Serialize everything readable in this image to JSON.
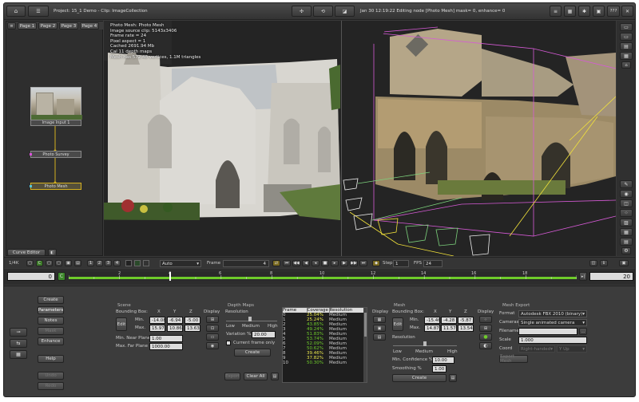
{
  "titlebar": {
    "project": "Project: 15_1 Demo - Clip: ImageCollection",
    "status": "Jan 30 12:19:22 Editing node [Photo Mesh] mask= 0, enhance= 0",
    "help_label": "???"
  },
  "tabs": [
    "Page 1",
    "Page 2",
    "Page 3",
    "Page 4"
  ],
  "nodes": [
    {
      "label": "Image Input 1"
    },
    {
      "label": "Photo Survey"
    },
    {
      "label": "Photo Mesh"
    }
  ],
  "left_bottom_tab": "Curve Editor",
  "viewport_overlay": [
    "Photo Mesh: Photo Mesh",
    "Image source clip: 5143x3406",
    "Frame rate = 24",
    "Pixel aspect = 1",
    "Cached 2691.94 Mb",
    "Cal 11 depth maps",
    "Mesh has 572.48 vertices, 1.1M triangles"
  ],
  "transport": {
    "zoom": "1/4K",
    "view_buttons": [
      "1",
      "2",
      "3",
      "4"
    ],
    "mode": "Auto",
    "frame_label": "Frame",
    "frame_value": "4",
    "step_label": "Step",
    "step_value": "1",
    "fps_label": "FPS",
    "fps_value": "24"
  },
  "timeline": {
    "start": "0",
    "end": "20",
    "ticks": [
      "2",
      "4",
      "6",
      "8",
      "10",
      "12",
      "14",
      "16",
      "18"
    ],
    "current_frame": 4
  },
  "left_buttons": [
    "Create",
    "Parameters",
    "Notes",
    "Mask",
    "Enhance",
    "Help",
    "Undo",
    "Redo"
  ],
  "scene": {
    "title": "Scene",
    "bbox_label": "Bounding Box:",
    "edit": "Edit",
    "axes": [
      "X",
      "Y",
      "Z"
    ],
    "display": "Display",
    "min_label": "Min.",
    "max_label": "Max.",
    "min": [
      "-14.08",
      "-6.94",
      "-5.00"
    ],
    "max": [
      "15.97",
      "10.86",
      "13.63"
    ],
    "near_label": "Min. Near Plane",
    "near_value": "1.00",
    "far_label": "Max. Far Plane",
    "far_value": "1000.00"
  },
  "depth_maps": {
    "title": "Depth Maps",
    "resolution": "Resolution",
    "low": "Low",
    "medium": "Medium",
    "high": "High",
    "variation_label": "Variation %",
    "variation_value": "20.00",
    "current_only": "Current frame only",
    "create": "Create",
    "export": "Export",
    "clear_all": "Clear All",
    "display": "Display",
    "columns": [
      "Frame",
      "Coverage",
      "Resolution"
    ],
    "rows": [
      [
        "0",
        "25.04%",
        "Medium"
      ],
      [
        "1",
        "25.24%",
        "Medium"
      ],
      [
        "2",
        "43.85%",
        "Medium"
      ],
      [
        "3",
        "49.24%",
        "Medium"
      ],
      [
        "4",
        "51.83%",
        "Medium"
      ],
      [
        "5",
        "53.74%",
        "Medium"
      ],
      [
        "6",
        "52.09%",
        "Medium"
      ],
      [
        "7",
        "50.62%",
        "Medium"
      ],
      [
        "8",
        "39.46%",
        "Medium"
      ],
      [
        "9",
        "37.82%",
        "Medium"
      ],
      [
        "10",
        "50.30%",
        "Medium"
      ]
    ]
  },
  "mesh": {
    "title": "Mesh",
    "bbox_label": "Bounding Box:",
    "edit": "Edit",
    "axes": [
      "X",
      "Y",
      "Z"
    ],
    "display": "Display",
    "min_label": "Min.",
    "max_label": "Max.",
    "min": [
      "-15.46",
      "-4.28",
      "-5.87"
    ],
    "max": [
      "14.87",
      "11.57",
      "13.54"
    ],
    "resolution": "Resolution",
    "low": "Low",
    "medium": "Medium",
    "high": "High",
    "confidence_label": "Min. Confidence %",
    "confidence_value": "10.00",
    "smoothing_label": "Smoothing %",
    "smoothing_value": "1.00",
    "create": "Create"
  },
  "mesh_export": {
    "title": "Mesh Export",
    "format_label": "Format",
    "format_value": "Autodesk FBX 2010 (binary)",
    "cameras_label": "Cameras",
    "cameras_value": "Single animated camera",
    "filename_label": "Filename",
    "filename_value": "",
    "scale_label": "Scale",
    "scale_value": "1.000",
    "coord_label": "Coord",
    "coord_value": "Right-handed",
    "up_value": "Y Up",
    "export": "Export Mesh"
  },
  "colors": {
    "accent_green": "#6ecb2a",
    "timeline_yellow": "#d4c84a",
    "camera_green": "#7cd27c",
    "camera_yellow": "#f2e23a",
    "bbox_magenta": "#d65ad6",
    "coverage_yellow": "#e8e64c"
  }
}
